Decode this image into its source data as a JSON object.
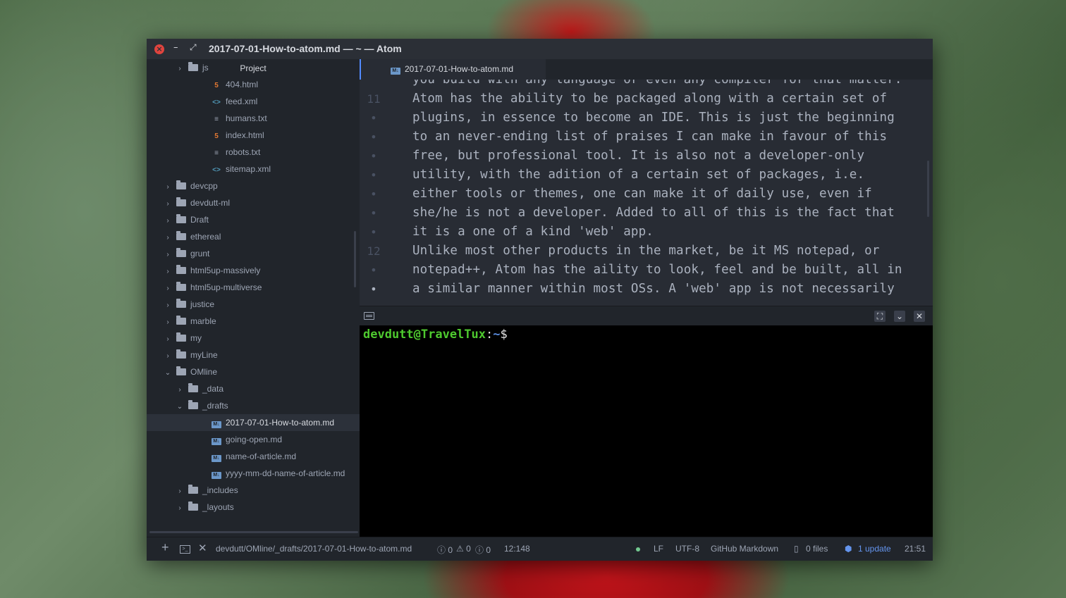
{
  "window": {
    "title": "2017-07-01-How-to-atom.md — ~ — Atom",
    "close_glyph": "×",
    "minimize_glyph": "–",
    "maximize_glyph": "⤢"
  },
  "sidebar": {
    "header": "Project",
    "items": [
      {
        "label": "js",
        "type": "folder",
        "depth": 1,
        "expanded": false
      },
      {
        "label": "404.html",
        "type": "html",
        "depth": 2
      },
      {
        "label": "feed.xml",
        "type": "xml",
        "depth": 2
      },
      {
        "label": "humans.txt",
        "type": "txt",
        "depth": 2
      },
      {
        "label": "index.html",
        "type": "html",
        "depth": 2
      },
      {
        "label": "robots.txt",
        "type": "txt",
        "depth": 2
      },
      {
        "label": "sitemap.xml",
        "type": "xml",
        "depth": 2
      },
      {
        "label": "devcpp",
        "type": "folder",
        "depth": 0,
        "expanded": false
      },
      {
        "label": "devdutt-ml",
        "type": "folder",
        "depth": 0,
        "expanded": false
      },
      {
        "label": "Draft",
        "type": "folder",
        "depth": 0,
        "expanded": false
      },
      {
        "label": "ethereal",
        "type": "folder",
        "depth": 0,
        "expanded": false
      },
      {
        "label": "grunt",
        "type": "folder",
        "depth": 0,
        "expanded": false
      },
      {
        "label": "html5up-massively",
        "type": "folder",
        "depth": 0,
        "expanded": false
      },
      {
        "label": "html5up-multiverse",
        "type": "folder",
        "depth": 0,
        "expanded": false
      },
      {
        "label": "justice",
        "type": "folder",
        "depth": 0,
        "expanded": false
      },
      {
        "label": "marble",
        "type": "folder",
        "depth": 0,
        "expanded": false
      },
      {
        "label": "my",
        "type": "folder",
        "depth": 0,
        "expanded": false
      },
      {
        "label": "myLine",
        "type": "folder",
        "depth": 0,
        "expanded": false
      },
      {
        "label": "OMline",
        "type": "folder",
        "depth": 0,
        "expanded": true
      },
      {
        "label": "_data",
        "type": "folder",
        "depth": 1,
        "expanded": false
      },
      {
        "label": "_drafts",
        "type": "folder",
        "depth": 1,
        "expanded": true
      },
      {
        "label": "2017-07-01-How-to-atom.md",
        "type": "md",
        "depth": 2,
        "selected": true
      },
      {
        "label": "going-open.md",
        "type": "md",
        "depth": 2
      },
      {
        "label": "name-of-article.md",
        "type": "md",
        "depth": 2
      },
      {
        "label": "yyyy-mm-dd-name-of-article.md",
        "type": "md",
        "depth": 2
      },
      {
        "label": "_includes",
        "type": "folder",
        "depth": 1,
        "expanded": false
      },
      {
        "label": "_layouts",
        "type": "folder",
        "depth": 1,
        "expanded": false
      }
    ]
  },
  "tab": {
    "label": "2017-07-01-How-to-atom.md",
    "icon_text": "M↓"
  },
  "editor": {
    "lines": [
      {
        "gutter": "",
        "text": "you build with any language or even any compiler for that matter."
      },
      {
        "gutter": "11",
        "text": "Atom has the ability to be packaged along with a certain set of"
      },
      {
        "gutter": "•",
        "text": "plugins, in essence to become an IDE. This is just the beginning"
      },
      {
        "gutter": "•",
        "text": "to an never-ending list of praises I can make in favour of this"
      },
      {
        "gutter": "•",
        "text": "free, but professional tool. It is also not a developer-only"
      },
      {
        "gutter": "•",
        "text": "utility, with the adition of a certain set of packages, i.e."
      },
      {
        "gutter": "•",
        "text": "either tools or themes, one can make it of daily use, even if"
      },
      {
        "gutter": "•",
        "text": "she/he is not a developer. Added to all of this is the fact that"
      },
      {
        "gutter": "•",
        "text": "it is a one of a kind 'web' app."
      },
      {
        "gutter": "12",
        "text": "Unlike most other products in the market, be it MS notepad, or"
      },
      {
        "gutter": "•",
        "text": "notepad++, Atom has the aility to look, feel and be built, all in"
      },
      {
        "gutter": "•",
        "text": "a similar manner within most OSs. A 'web' app is not necessarily"
      }
    ]
  },
  "terminal": {
    "user_host": "devdutt@TravelTux",
    "separator": ":",
    "cwd": "~",
    "prompt_symbol": "$",
    "buttons": {
      "maximize": "⛶",
      "hide": "⌄",
      "close": "✕"
    }
  },
  "statusbar": {
    "add_glyph": "+",
    "terminal_glyph": ">_",
    "close_glyph": "✕",
    "file_path": "devdutt/OMline/_drafts/2017-07-01-How-to-atom.md",
    "errors": "ⓘ 0",
    "warnings": "⚠ 0",
    "infos": "ⓘ 0",
    "cursor_position": "12:148",
    "line_ending": "LF",
    "encoding": "UTF-8",
    "grammar": "GitHub Markdown",
    "git_files": "0 files",
    "updates": "1 update",
    "clock": "21:51"
  },
  "colors": {
    "accent": "#528bff",
    "prompt_user": "#4ec92f",
    "prompt_dir": "#5b8de0",
    "update_link": "#6494ed",
    "close_button": "#e0443e"
  }
}
